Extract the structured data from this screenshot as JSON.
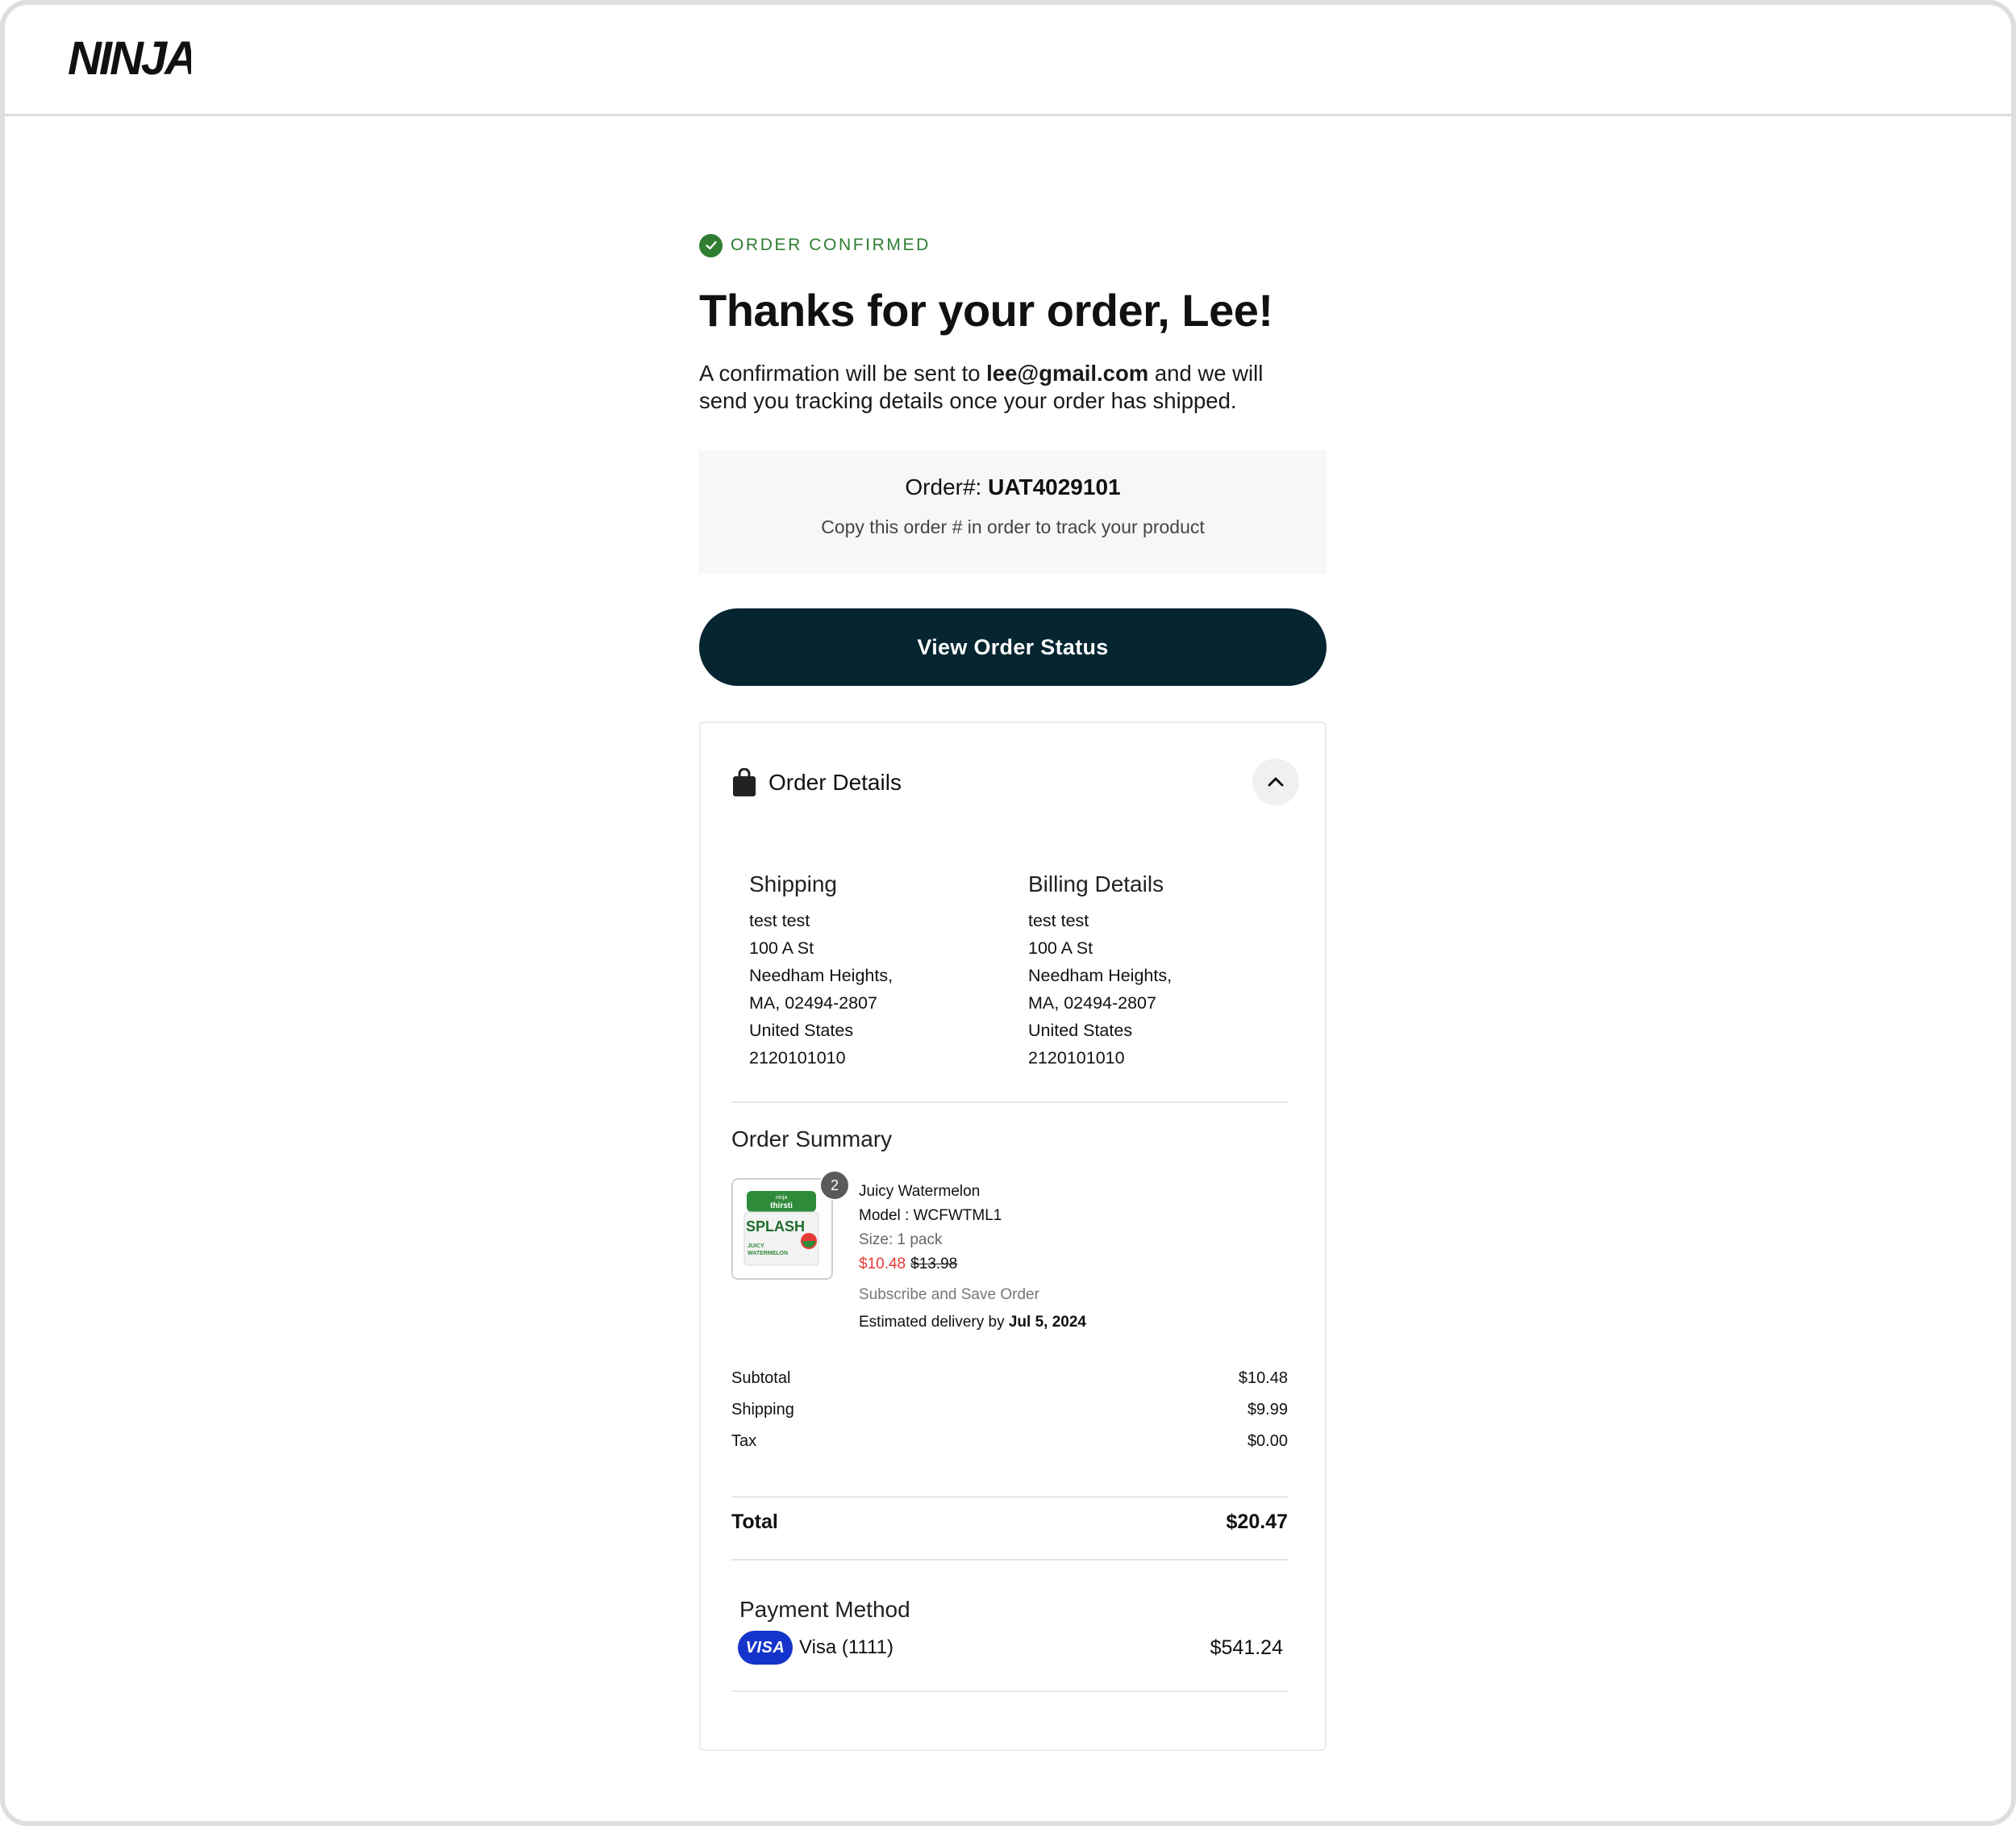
{
  "header": {
    "logo_text": "NINJA"
  },
  "confirmation": {
    "badge": "ORDER CONFIRMED",
    "title": "Thanks for your order, Lee!",
    "lead_prefix": "A confirmation will be sent to ",
    "email": "lee@gmail.com",
    "lead_suffix": " and we will send you tracking details once your order has shipped."
  },
  "order": {
    "number_label": "Order#: ",
    "number": "UAT4029101",
    "hint": "Copy this order # in order to track your product"
  },
  "actions": {
    "view_status": "View Order Status"
  },
  "details": {
    "title": "Order Details",
    "shipping": {
      "heading": "Shipping",
      "lines": [
        "test test",
        "100 A St",
        "Needham Heights,",
        "MA, 02494-2807",
        "United States",
        "2120101010"
      ]
    },
    "billing": {
      "heading": "Billing Details",
      "lines": [
        "test test",
        "100 A St",
        "Needham Heights,",
        "MA, 02494-2807",
        "United States",
        "2120101010"
      ]
    },
    "summary": {
      "heading": "Order Summary",
      "item": {
        "quantity": "2",
        "name": "Juicy Watermelon",
        "model": "Model : WCFWTML1",
        "size": "Size: 1 pack",
        "sale_price": "$10.48",
        "original_price": "$13.98",
        "subscription": "Subscribe and Save Order",
        "eta_label": "Estimated delivery by ",
        "eta_date": "Jul 5, 2024",
        "image_text": {
          "brand": "thirsti",
          "product": "SPLASH",
          "flavor": "JUICY WATERMELON"
        }
      },
      "rows": [
        {
          "label": "Subtotal",
          "value": "$10.48"
        },
        {
          "label": "Shipping",
          "value": "$9.99"
        },
        {
          "label": "Tax",
          "value": "$0.00"
        }
      ],
      "total_label": "Total",
      "total_value": "$20.47"
    },
    "payment": {
      "heading": "Payment Method",
      "brand": "VISA",
      "card": "Visa (1111)",
      "amount": "$541.24"
    }
  },
  "colors": {
    "accent_green": "#2e7d32",
    "button_bg": "#052530",
    "sale_red": "#e53935",
    "visa_blue": "#1434cb"
  }
}
